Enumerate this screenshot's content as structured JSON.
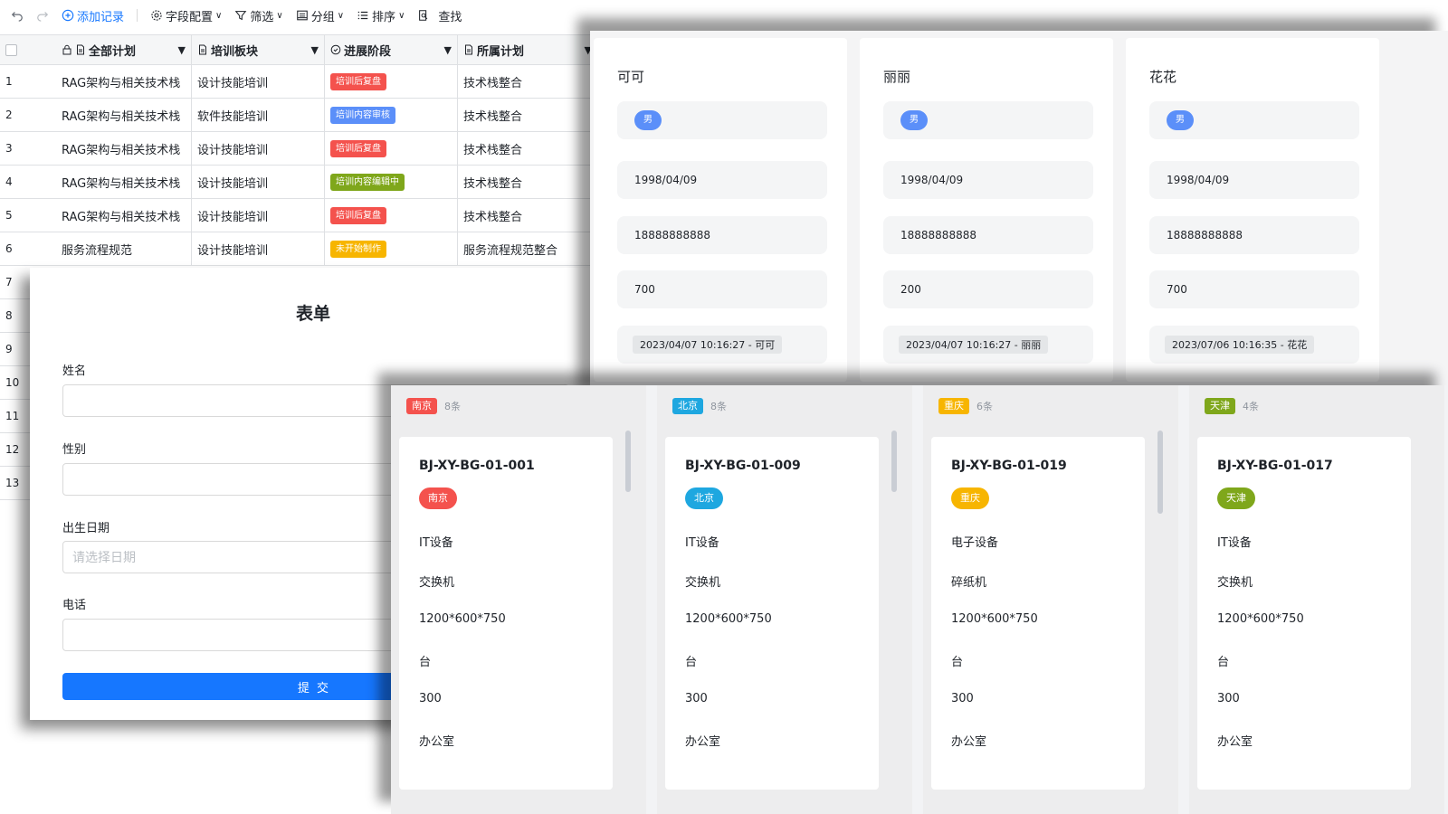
{
  "toolbar": {
    "add_record": "添加记录",
    "field_config": "字段配置",
    "filter": "筛选",
    "group": "分组",
    "sort": "排序",
    "search": "查找"
  },
  "table": {
    "columns": [
      "全部计划",
      "培训板块",
      "进展阶段",
      "所属计划"
    ],
    "rows": [
      {
        "num": "1",
        "plan": "RAG架构与相关技术栈",
        "module": "设计技能培训",
        "stage": "培训后复盘",
        "stage_color": "#f4524d",
        "belong": "技术栈整合"
      },
      {
        "num": "2",
        "plan": "RAG架构与相关技术栈",
        "module": "软件技能培训",
        "stage": "培训内容审核",
        "stage_color": "#5b8ff9",
        "belong": "技术栈整合"
      },
      {
        "num": "3",
        "plan": "RAG架构与相关技术栈",
        "module": "设计技能培训",
        "stage": "培训后复盘",
        "stage_color": "#f4524d",
        "belong": "技术栈整合"
      },
      {
        "num": "4",
        "plan": "RAG架构与相关技术栈",
        "module": "设计技能培训",
        "stage": "培训内容编辑中",
        "stage_color": "#7fa71b",
        "belong": "技术栈整合"
      },
      {
        "num": "5",
        "plan": "RAG架构与相关技术栈",
        "module": "设计技能培训",
        "stage": "培训后复盘",
        "stage_color": "#f4524d",
        "belong": "技术栈整合"
      },
      {
        "num": "6",
        "plan": "服务流程规范",
        "module": "设计技能培训",
        "stage": "未开始制作",
        "stage_color": "#f7b500",
        "belong": "服务流程规范整合"
      }
    ],
    "extra_row_numbers": [
      "7",
      "8",
      "9",
      "10",
      "11",
      "12",
      "13"
    ]
  },
  "form": {
    "title": "表单",
    "name_label": "姓名",
    "gender_label": "性别",
    "birth_label": "出生日期",
    "birth_placeholder": "请选择日期",
    "phone_label": "电话",
    "submit": "提 交"
  },
  "gallery": {
    "cards": [
      {
        "name": "可可",
        "gender": "男",
        "birth": "1998/04/09",
        "phone": "18888888888",
        "amount": "700",
        "stamp": "2023/04/07 10:16:27 - 可可"
      },
      {
        "name": "丽丽",
        "gender": "男",
        "birth": "1998/04/09",
        "phone": "18888888888",
        "amount": "200",
        "stamp": "2023/04/07 10:16:27 - 丽丽"
      },
      {
        "name": "花花",
        "gender": "男",
        "birth": "1998/04/09",
        "phone": "18888888888",
        "amount": "700",
        "stamp": "2023/07/06 10:16:35 - 花花"
      }
    ]
  },
  "kanban": {
    "columns": [
      {
        "tag": "南京",
        "color": "#f4524d",
        "count": "8条",
        "code": "BJ-XY-BG-01-001",
        "category": "IT设备",
        "item": "交换机",
        "size": "1200*600*750",
        "unit": "台",
        "qty": "300",
        "place": "办公室"
      },
      {
        "tag": "北京",
        "color": "#1ea7e0",
        "count": "8条",
        "code": "BJ-XY-BG-01-009",
        "category": "IT设备",
        "item": "交换机",
        "size": "1200*600*750",
        "unit": "台",
        "qty": "300",
        "place": "办公室"
      },
      {
        "tag": "重庆",
        "color": "#f7b500",
        "count": "6条",
        "code": "BJ-XY-BG-01-019",
        "category": "电子设备",
        "item": "碎纸机",
        "size": "1200*600*750",
        "unit": "台",
        "qty": "300",
        "place": "办公室"
      },
      {
        "tag": "天津",
        "color": "#7fa71b",
        "count": "4条",
        "code": "BJ-XY-BG-01-017",
        "category": "IT设备",
        "item": "交换机",
        "size": "1200*600*750",
        "unit": "台",
        "qty": "300",
        "place": "办公室"
      }
    ]
  }
}
